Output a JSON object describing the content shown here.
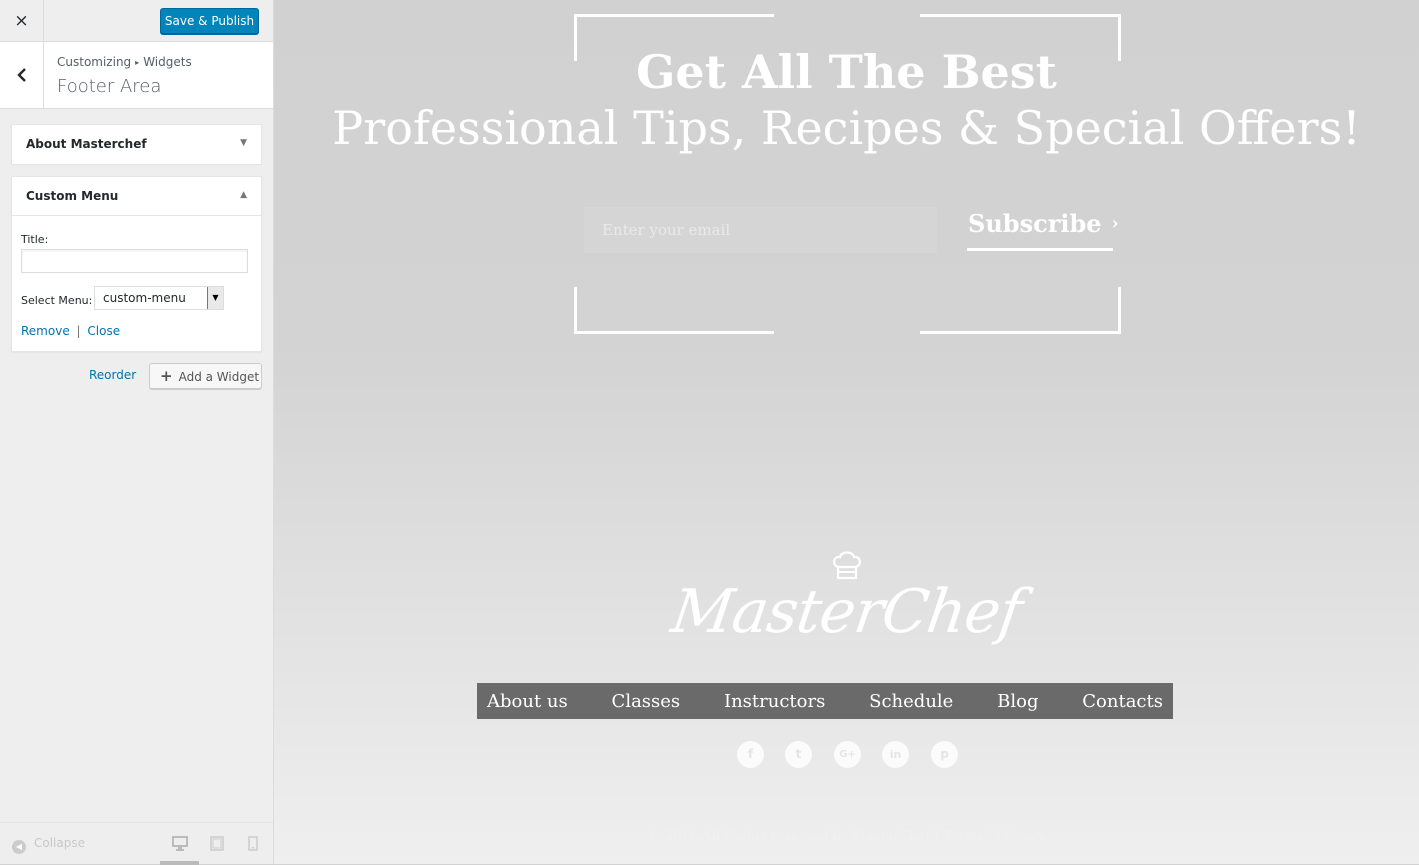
{
  "topbar": {
    "close_icon": "×",
    "publish_label": "Save & Publish",
    "publish_color": "#0085ba"
  },
  "title_panel": {
    "breadcrumb_root": "Customizing",
    "breadcrumb_section": "Widgets",
    "title": "Footer Area"
  },
  "widgets": [
    {
      "title": "About Masterchef",
      "state": "collapsed"
    },
    {
      "title": "Custom Menu",
      "state": "expanded",
      "title_field_label": "Title:",
      "title_value": "",
      "select_label": "Select Menu:",
      "select_value": "custom-menu",
      "remove_label": "Remove",
      "separator": "|",
      "close_label": "Close"
    }
  ],
  "actions": {
    "reorder_label": "Reorder",
    "add_widget_label": "Add a Widget"
  },
  "footer_bar": {
    "collapse_label": "Collapse"
  },
  "preview": {
    "headline": "Get All The Best",
    "subheadline": "Professional Tips, Recipes & Special Offers!",
    "email_placeholder": "Enter your email",
    "subscribe_label": "Subscribe",
    "logo_text": "MasterChef",
    "nav": [
      "About us",
      "Classes",
      "Instructors",
      "Schedule",
      "Blog",
      "Contacts"
    ],
    "socials": [
      "facebook-icon",
      "twitter-icon",
      "google-plus-icon",
      "linkedin-icon",
      "pinterest-icon"
    ],
    "copyright": "© 2016 All Rights reserved by MasterChef  |  Terms  /  Privacy"
  }
}
